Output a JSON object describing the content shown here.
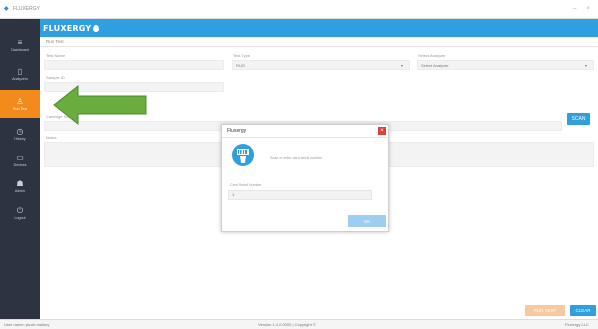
{
  "window": {
    "title": "FLUXERGY"
  },
  "brand": {
    "logo_text": "FLUXERGY"
  },
  "sidebar": {
    "items": [
      {
        "label": "Dashboard",
        "icon": "menu-icon"
      },
      {
        "label": "Analyzers",
        "icon": "analyzer-icon"
      },
      {
        "label": "Run Test",
        "icon": "person-icon"
      },
      {
        "label": "History",
        "icon": "clock-icon"
      },
      {
        "label": "Devices",
        "icon": "monitor-icon"
      },
      {
        "label": "Admin",
        "icon": "users-icon"
      },
      {
        "label": "Logout",
        "icon": "power-icon"
      }
    ]
  },
  "main": {
    "subtitle": "Run Test",
    "fields": {
      "test_name_label": "Test Name",
      "test_type_label": "Test Type",
      "test_type_value": "RUO",
      "select_analyzer_label": "Select Analyzer",
      "select_analyzer_value": "Select Analyzer",
      "sample_id_label": "Sample ID",
      "cartridge_label": "Cartridge Serial",
      "notes_label": "Notes"
    },
    "scan_label": "SCAN",
    "run_test_label": "RUN TEST",
    "clear_label": "CLEAR"
  },
  "dialog": {
    "title": "Fluxergy",
    "close_glyph": "×",
    "message": "Scan or enter card serial number",
    "serial_label": "Card Serial Number",
    "serial_value": "1",
    "ok_label": "OK"
  },
  "statusbar": {
    "user": "User name: jacob.mallory",
    "version": "Version 1.4.0.0000   |   Copyright ©",
    "right": "Fluxergy LLC"
  },
  "colors": {
    "accent": "#2f9fe0",
    "active": "#f28a1c",
    "sidebar": "#2b3440",
    "arrow": "#6aac3d"
  }
}
